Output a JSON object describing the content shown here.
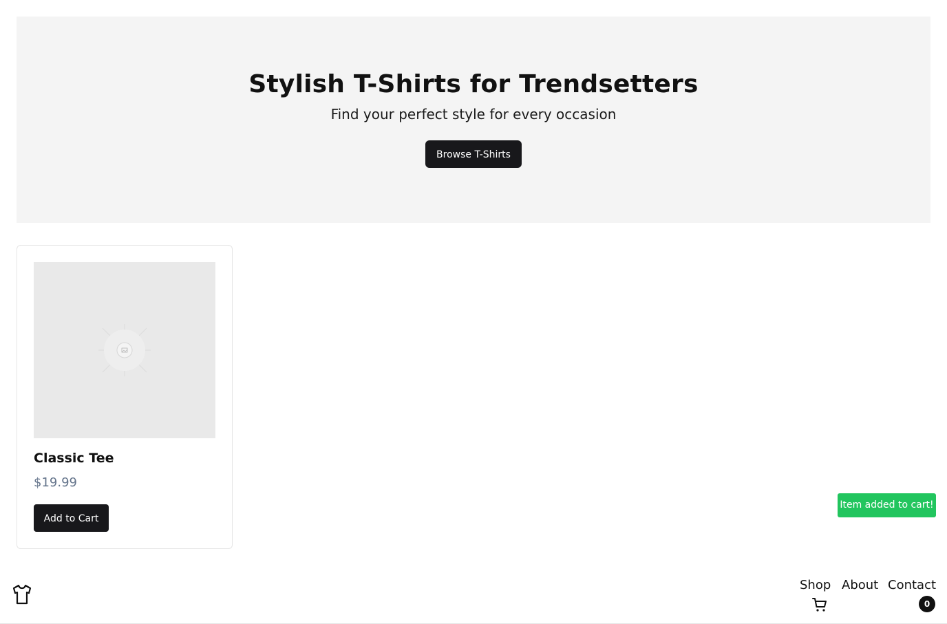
{
  "hero": {
    "title": "Stylish T-Shirts for Trendsetters",
    "subtitle": "Find your perfect style for every occasion",
    "button_label": "Browse T-Shirts"
  },
  "products": [
    {
      "name": "Classic Tee",
      "price": "$19.99",
      "button_label": "Add to Cart",
      "image_icon": "image-placeholder-icon"
    }
  ],
  "toast": {
    "message": "Item added to cart!",
    "color": "#22c55e"
  },
  "footer": {
    "logo_icon": "tshirt-icon",
    "nav": {
      "shop": "Shop",
      "about": "About",
      "contact": "Contact"
    },
    "cart_icon": "cart-icon",
    "cart_count": "0"
  },
  "colors": {
    "primary_button": "#18181b",
    "hero_background": "#f4f4f4",
    "price_text": "#64748b"
  }
}
